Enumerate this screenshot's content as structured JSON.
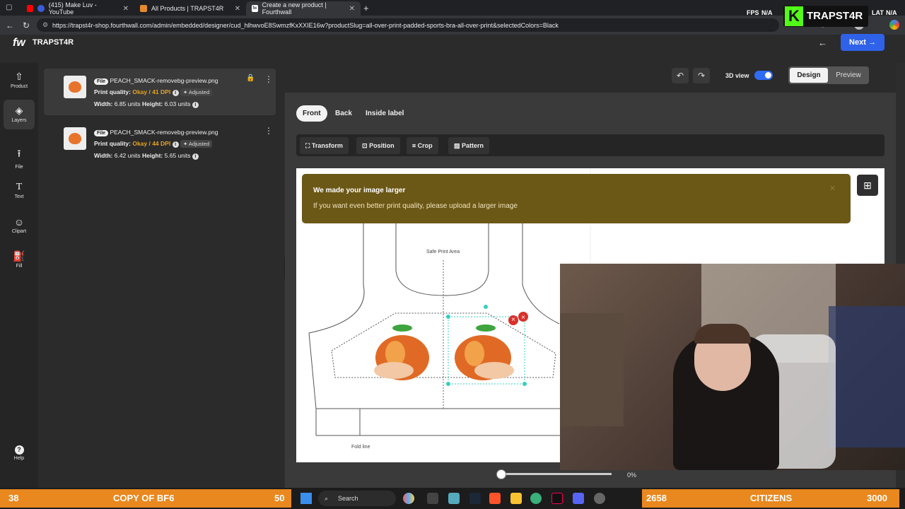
{
  "browser": {
    "tabs": [
      {
        "title": "(415) Make Luv - YouTube",
        "color": "#ff0000"
      },
      {
        "title": "All Products | TRAPST4R",
        "color": "#e58a2a"
      },
      {
        "title": "Create a new product | Fourthwall",
        "color": "#ffffff"
      }
    ],
    "url": "https://trapst4r-shop.fourthwall.com/admin/embedded/designer/cud_hlhwvoE8SwmzfKxXXIE16w?productSlug=all-over-print-padded-sports-bra-all-over-print&selectedColors=Black",
    "fps_label": "FPS",
    "fps_value": "N/A",
    "lat_label": "LAT",
    "lat_value": "N/A"
  },
  "app": {
    "logo": "fw",
    "brand": "TRAPST4R",
    "next_label": "Next",
    "view_3d_label": "3D view",
    "design_label": "Design",
    "preview_label": "Preview"
  },
  "leftnav": [
    {
      "label": "Product",
      "icon": "shirt-icon",
      "glyph": "👕"
    },
    {
      "label": "Layers",
      "icon": "layers-icon",
      "glyph": "◈"
    },
    {
      "label": "File",
      "icon": "upload-icon",
      "glyph": "⬆"
    },
    {
      "label": "Text",
      "icon": "text-icon",
      "glyph": "T"
    },
    {
      "label": "Clipart",
      "icon": "smiley-icon",
      "glyph": "☺"
    },
    {
      "label": "Fill",
      "icon": "paint-bucket-icon",
      "glyph": "🪣"
    },
    {
      "label": "Help",
      "icon": "help-icon",
      "glyph": "?"
    }
  ],
  "layers": [
    {
      "chip": "File",
      "name": "PEACH_SMACK-removebg-preview.png",
      "quality_label": "Print quality:",
      "quality": "Okay / 41 DPI",
      "adjusted": "Adjusted",
      "width_label": "Width:",
      "width": "6.85 units",
      "height_label": "Height:",
      "height": "6.03 units"
    },
    {
      "chip": "File",
      "name": "PEACH_SMACK-removebg-preview.png",
      "quality_label": "Print quality:",
      "quality": "Okay / 44 DPI",
      "adjusted": "Adjusted",
      "width_label": "Width:",
      "width": "6.42 units",
      "height_label": "Height:",
      "height": "5.65 units"
    }
  ],
  "sides": [
    "Front",
    "Back",
    "Inside label"
  ],
  "tools": [
    "Transform",
    "Position",
    "Crop",
    "Pattern"
  ],
  "banner": {
    "title": "We made your image larger",
    "body": "If you want even better print quality, please upload a larger image"
  },
  "canvas": {
    "safe_area": "Safe Print Area",
    "fold_line": "Fold line",
    "zoom": "0%"
  },
  "stream": {
    "left_count": "38",
    "left_title": "COPY OF BF6",
    "left_value": "50",
    "right_count": "2658",
    "right_title": "CITIZENS",
    "right_value": "3000",
    "overlay_brand": "TRAPST4R",
    "overlay_logo": "K"
  },
  "taskbar": {
    "search_placeholder": "Search"
  },
  "colors": {
    "accent": "#2f62e8",
    "warning_bg": "#6b5716",
    "okay": "#e5a323",
    "stream_bar": "#e8881e"
  }
}
